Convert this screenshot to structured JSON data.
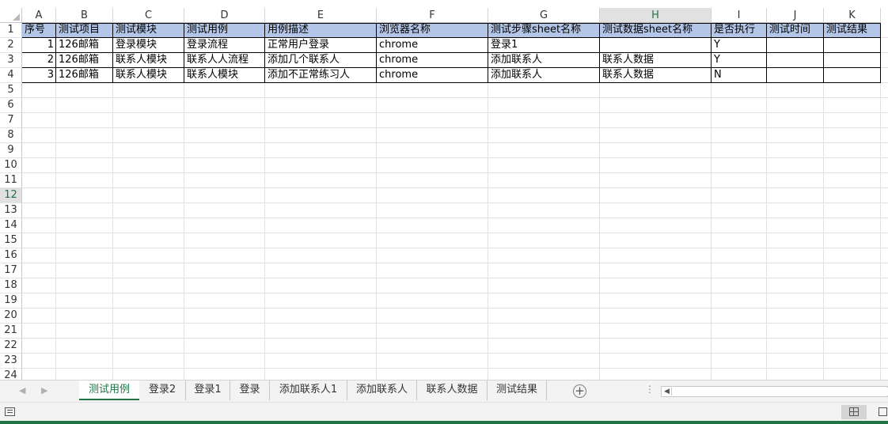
{
  "columns": [
    "A",
    "B",
    "C",
    "D",
    "E",
    "F",
    "G",
    "H",
    "I",
    "J",
    "K"
  ],
  "selected_column": "H",
  "selected_row": "12",
  "row_numbers": [
    "1",
    "2",
    "3",
    "4",
    "5",
    "6",
    "7",
    "8",
    "9",
    "10",
    "11",
    "12",
    "13",
    "14",
    "15",
    "16",
    "17",
    "18",
    "19",
    "20",
    "21",
    "22",
    "23",
    "24"
  ],
  "header_row": [
    "序号",
    "测试项目",
    "测试模块",
    "测试用例",
    "用例描述",
    "浏览器名称",
    "测试步骤sheet名称",
    "测试数据sheet名称",
    "是否执行",
    "测试时间",
    "测试结果"
  ],
  "data_rows": [
    [
      "1",
      "126邮箱",
      "登录模块",
      "登录流程",
      "正常用户登录",
      "chrome",
      "登录1",
      "",
      "Y",
      "",
      ""
    ],
    [
      "2",
      "126邮箱",
      "联系人模块",
      "联系人人流程",
      "添加几个联系人",
      "chrome",
      "添加联系人",
      "联系人数据",
      "Y",
      "",
      ""
    ],
    [
      "3",
      "126邮箱",
      "联系人模块",
      "联系人模块",
      "添加不正常练习人",
      "chrome",
      "添加联系人",
      "联系人数据",
      "N",
      "",
      ""
    ]
  ],
  "sheet_tabs": [
    "测试用例",
    "登录2",
    "登录1",
    "登录",
    "添加联系人1",
    "添加联系人",
    "联系人数据",
    "测试结果"
  ],
  "active_sheet": "测试用例",
  "icons": {
    "prev_sheet": "triangle-left-icon",
    "next_sheet": "triangle-right-icon",
    "add_sheet": "plus-circle-icon",
    "more": "vertical-dots-icon",
    "status": "cell-mode-icon",
    "normal_view": "grid-view-icon",
    "page_layout": "page-layout-icon"
  },
  "colors": {
    "header_fill": "#b4c6e7",
    "accent": "#217346",
    "grid": "#e1e1e1"
  }
}
